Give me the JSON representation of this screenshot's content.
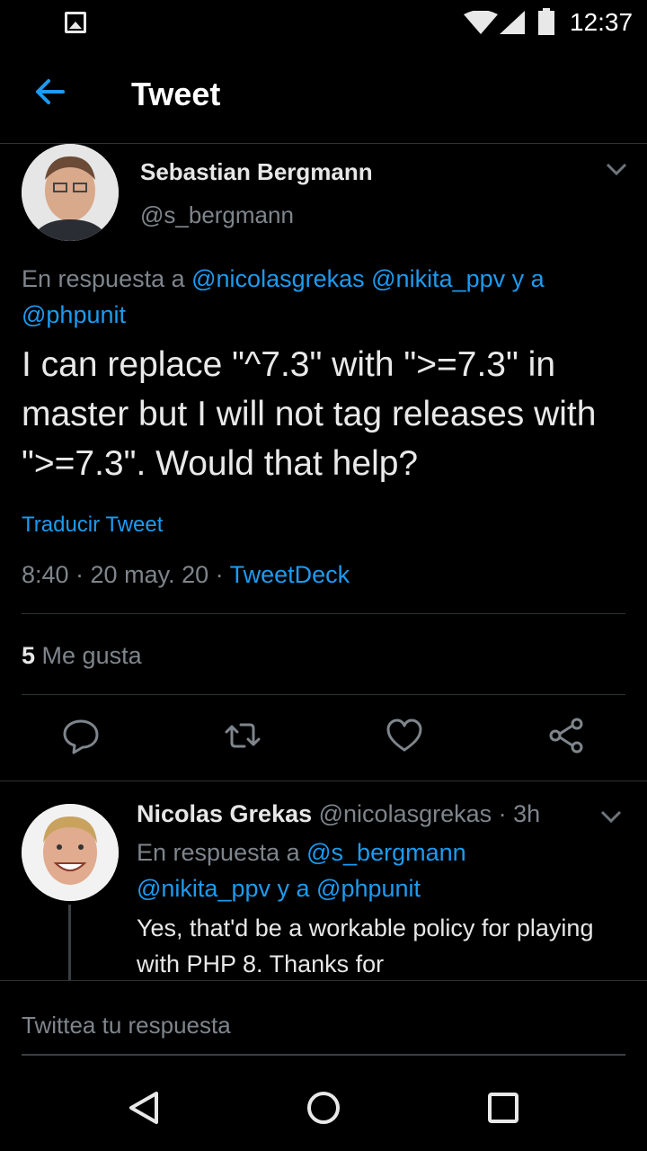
{
  "status_bar": {
    "time": "12:37"
  },
  "app_bar": {
    "title": "Tweet"
  },
  "main_tweet": {
    "author_name": "Sebastian Bergmann",
    "handle": "@s_bergmann",
    "reply_prefix": "En respuesta a ",
    "reply_user1": "@nicolasgrekas",
    "reply_user2": "@nikita_ppv",
    "reply_and": " y a",
    "reply_user3": "@phpunit",
    "text": "I can replace \"^7.3\" with \">=7.3\" in master but I will not tag releases with \">=7.3\". Would that help?",
    "translate": "Traducir Tweet",
    "timestamp": "8:40 · 20 may. 20 · ",
    "source": "TweetDeck",
    "likes_count": "5",
    "likes_label": "Me gusta"
  },
  "reply_tweet": {
    "author_name": "Nicolas Grekas",
    "handle_time": " @nicolasgrekas · 3h",
    "reply_prefix": "En respuesta a ",
    "reply_user1": "@s_bergmann",
    "reply_user2": "@nikita_ppv",
    "reply_and": " y a ",
    "reply_user3": "@phpunit",
    "text": "Yes, that'd be a workable policy for playing with PHP 8. Thanks for"
  },
  "compose": {
    "placeholder": "Twittea tu respuesta"
  },
  "colors": {
    "accent": "#1d9bf0",
    "background": "#000000",
    "muted": "#7e858c"
  },
  "icons": [
    "image-icon",
    "wifi-icon",
    "signal-icon",
    "battery-icon",
    "back-arrow-icon",
    "chevron-down-icon",
    "reply-icon",
    "retweet-icon",
    "like-icon",
    "share-icon",
    "nav-back-icon",
    "nav-home-icon",
    "nav-recents-icon"
  ]
}
